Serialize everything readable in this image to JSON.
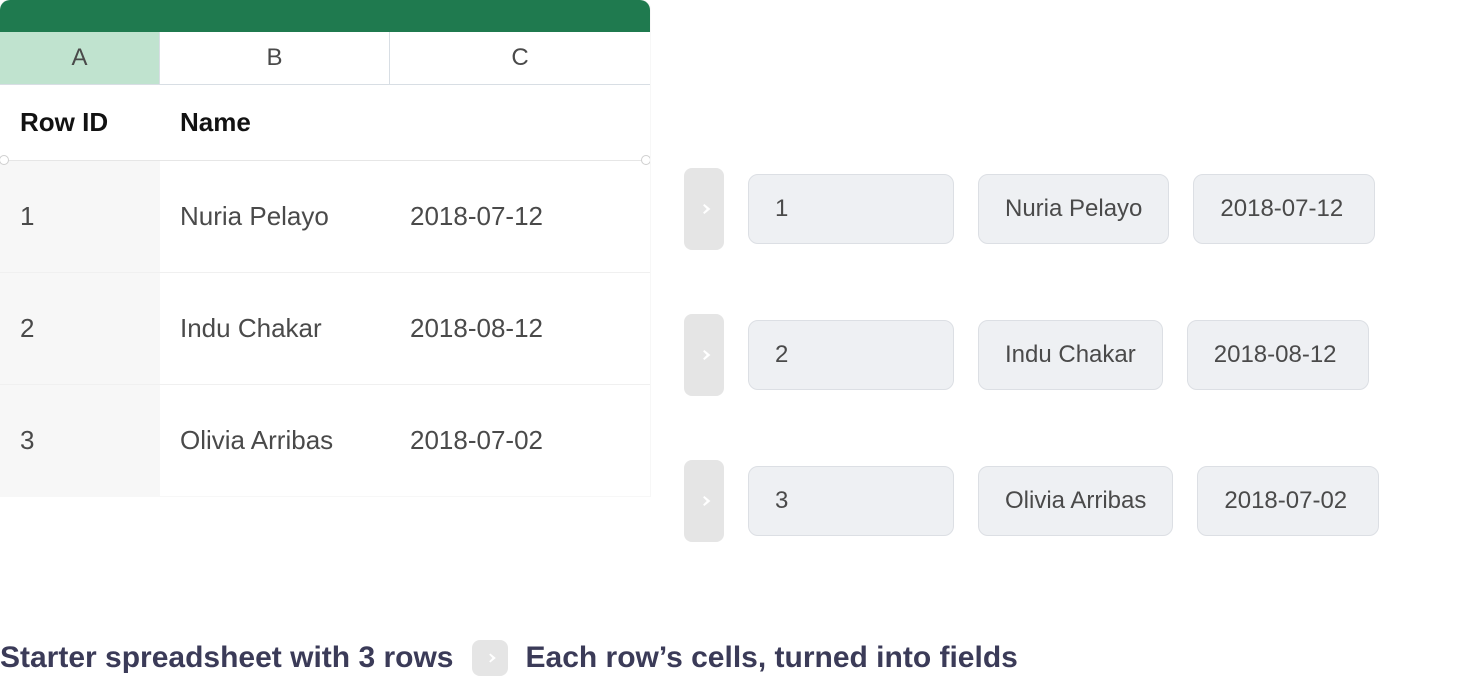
{
  "spreadsheet": {
    "columns": [
      "A",
      "B",
      "C"
    ],
    "headers": {
      "A": "Row ID",
      "B": "Name",
      "C": ""
    },
    "rows": [
      {
        "id": "1",
        "name": "Nuria Pelayo",
        "date": "2018-07-12"
      },
      {
        "id": "2",
        "name": "Indu Chakar",
        "date": "2018-08-12"
      },
      {
        "id": "3",
        "name": "Olivia Arribas",
        "date": "2018-07-02"
      }
    ]
  },
  "fields": [
    {
      "id": "1",
      "name": "Nuria Pelayo",
      "date": "2018-07-12"
    },
    {
      "id": "2",
      "name": "Indu Chakar",
      "date": "2018-08-12"
    },
    {
      "id": "3",
      "name": "Olivia Arribas",
      "date": "2018-07-02"
    }
  ],
  "captions": {
    "left": "Starter spreadsheet with 3 rows",
    "right": "Each row’s cells, turned into fields"
  }
}
